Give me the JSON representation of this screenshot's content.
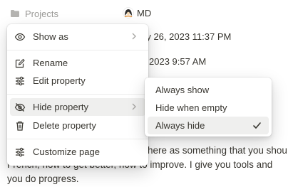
{
  "page": {
    "property_name": "Projects",
    "owner_initials": "MD",
    "date_line_1_fragment": "ry 26, 2023 11:37 PM",
    "date_line_2_fragment": "2023 9:57 AM",
    "body_line_1_fragment": "here as something that you shou",
    "body_line_2_fragment": "French, how to get better, how to improve. I give you tools and",
    "body_line_3_fragment": "you do progress."
  },
  "property_menu": {
    "items": [
      {
        "label": "Show as",
        "icon": "eye-icon",
        "submenu": true
      },
      {
        "label": "Rename",
        "icon": "edit-icon"
      },
      {
        "label": "Edit property",
        "icon": "sliders-icon"
      },
      {
        "label": "Hide property",
        "icon": "eye-off-icon",
        "submenu": true,
        "highlighted": true
      },
      {
        "label": "Delete property",
        "icon": "trash-icon"
      },
      {
        "label": "Customize page",
        "icon": "sliders-icon"
      }
    ]
  },
  "visibility_submenu": {
    "options": [
      "Always show",
      "Hide when empty",
      "Always hide"
    ],
    "selected": "Always hide"
  }
}
